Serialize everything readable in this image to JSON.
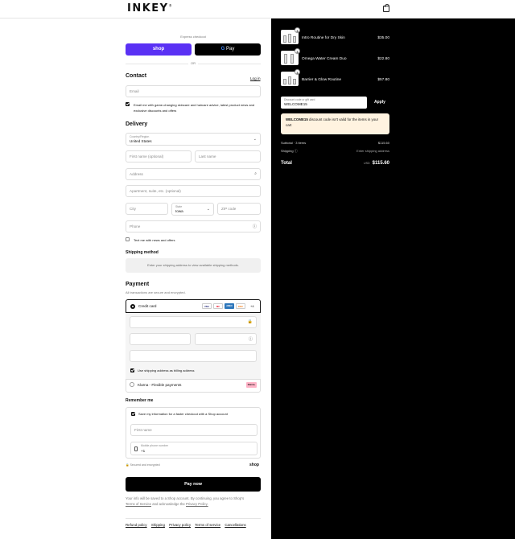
{
  "header": {
    "logo": "INKEY",
    "logo_suffix": "®"
  },
  "express": {
    "label": "Express checkout",
    "shop_label": "shop",
    "gpay_g": "G",
    "gpay_label": " Pay",
    "or": "OR"
  },
  "contact": {
    "title": "Contact",
    "login": "Log in",
    "email_placeholder": "Email",
    "optin": "Email me with game-changing skincare and haircare advice, latest product news and exclusive discounts and offers",
    "optin_checked": true
  },
  "delivery": {
    "title": "Delivery",
    "country_label": "Country/Region",
    "country_value": "United States",
    "first_name": "First name (optional)",
    "last_name": "Last name",
    "address": "Address",
    "apartment": "Apartment, suite, etc. (optional)",
    "city": "City",
    "state_label": "State",
    "state_value": "Iowa",
    "zip": "ZIP code",
    "phone": "Phone",
    "text_me": "Text me with news and offers"
  },
  "shipping": {
    "title": "Shipping method",
    "notice": "Enter your shipping address to view available shipping methods."
  },
  "payment": {
    "title": "Payment",
    "subtitle": "All transactions are secure and encrypted.",
    "credit_card": "Credit card",
    "card_icons": [
      "VISA",
      "MC",
      "AMEX",
      "DISC"
    ],
    "more": "+4",
    "billing": "Use shipping address as billing address",
    "klarna": "Klarna - Flexible payments",
    "klarna_badge": "Klarna."
  },
  "remember": {
    "title": "Remember me",
    "save": "Save my information for a faster checkout with a Shop account",
    "first_name": "First name",
    "mobile_label": "Mobile phone number",
    "mobile_prefix": "+1",
    "secure": "Secured and encrypted",
    "shop": "shop"
  },
  "pay_now": "Pay now",
  "legal": {
    "text_1": "Your info will be saved to a Shop account. By continuing, you agree to Shop's",
    "terms": "Terms of Service",
    "text_2": "and acknowledge the",
    "privacy": "Privacy Policy."
  },
  "footer_links": [
    "Refund policy",
    "Shipping",
    "Privacy policy",
    "Terms of service",
    "Cancellations"
  ],
  "cart": {
    "items": [
      {
        "name": "Intro Routine for Dry Skin",
        "price": "$35.00",
        "qty": "3"
      },
      {
        "name": "Omega Water Cream Duo",
        "price": "$22.80",
        "qty": "3"
      },
      {
        "name": "Barrier & Glow Routine",
        "price": "$57.80",
        "qty": "3"
      }
    ],
    "discount_label": "Discount code or gift card",
    "discount_value": "WELCOME15",
    "apply": "Apply",
    "alert_code": "WELCOME15",
    "alert_text": " discount code isn't valid for the items in your cart",
    "subtotal_label": "Subtotal · 3 items",
    "subtotal": "$115.60",
    "shipping_label": "Shipping",
    "shipping_value": "Enter shipping address",
    "total_label": "Total",
    "currency": "USD",
    "total": "$115.60"
  },
  "colors": {
    "shop_purple": "#5a31f4",
    "alert_bg": "#fff3e0",
    "klarna_pink": "#ffb3c7"
  }
}
